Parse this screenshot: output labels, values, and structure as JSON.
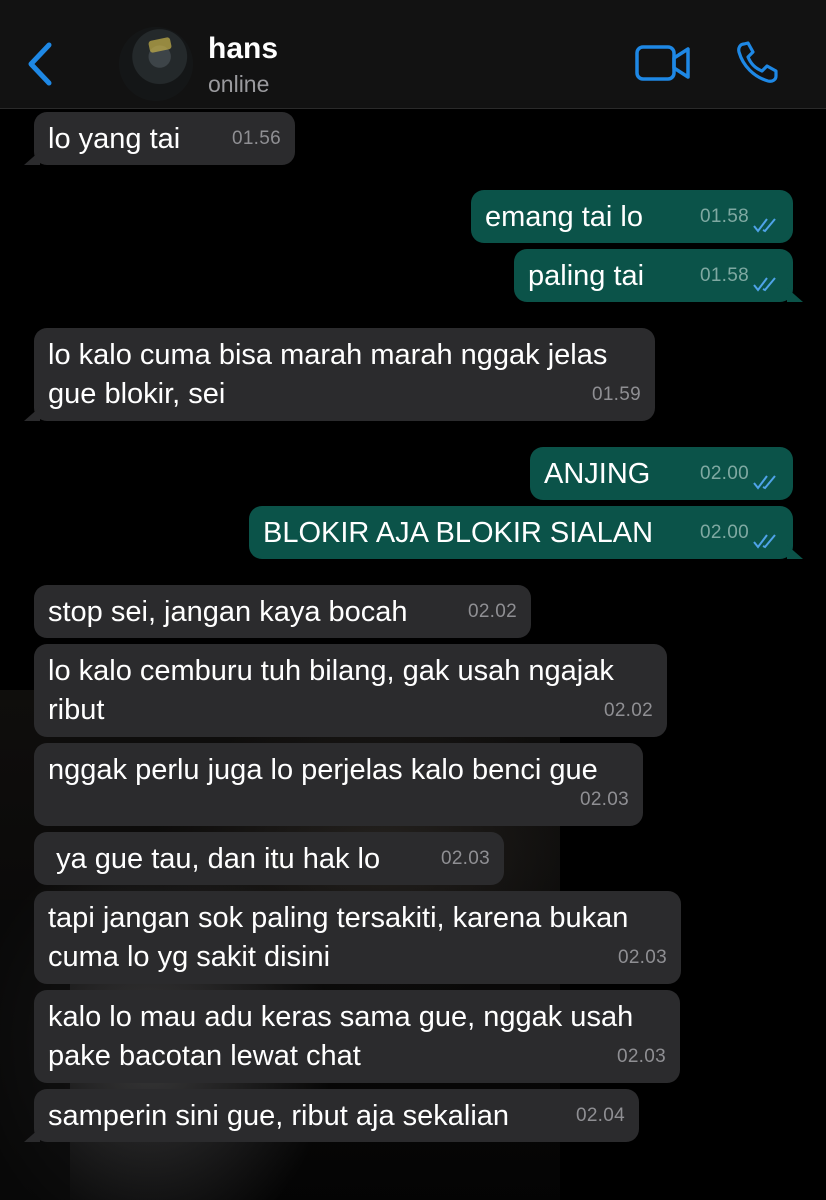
{
  "header": {
    "back_icon": "chevron-left-icon",
    "contact_name": "hans",
    "contact_status": "online",
    "video_icon": "video-camera-icon",
    "call_icon": "phone-icon",
    "accent_color": "#1e88e5"
  },
  "messages": [
    {
      "direction": "in",
      "text": "lo yang tai",
      "time": "01.56"
    },
    {
      "direction": "out",
      "text": "emang tai lo",
      "time": "01.58",
      "status": "read"
    },
    {
      "direction": "out",
      "text": "paling tai",
      "time": "01.58",
      "status": "read"
    },
    {
      "direction": "in",
      "text": "lo kalo cuma bisa marah marah nggak jelas\ngue blokir, sei",
      "time": "01.59"
    },
    {
      "direction": "out",
      "text": "ANJING",
      "time": "02.00",
      "status": "read"
    },
    {
      "direction": "out",
      "text": "BLOKIR AJA BLOKIR SIALAN",
      "time": "02.00",
      "status": "read"
    },
    {
      "direction": "in",
      "text": "stop sei, jangan kaya bocah",
      "time": "02.02"
    },
    {
      "direction": "in",
      "text": "lo kalo cemburu tuh bilang, gak usah ngajak\nribut",
      "time": "02.02"
    },
    {
      "direction": "in",
      "text": "nggak perlu juga lo perjelas kalo benci gue",
      "time": "02.03"
    },
    {
      "direction": "in",
      "text": " ya gue tau, dan itu hak lo",
      "time": "02.03"
    },
    {
      "direction": "in",
      "text": "tapi jangan sok paling tersakiti, karena bukan\ncuma lo yg sakit disini",
      "time": "02.03"
    },
    {
      "direction": "in",
      "text": "kalo lo mau adu keras sama gue, nggak usah\npake bacotan lewat chat",
      "time": "02.03"
    },
    {
      "direction": "in",
      "text": "samperin sini gue, ribut aja sekalian",
      "time": "02.04"
    }
  ]
}
